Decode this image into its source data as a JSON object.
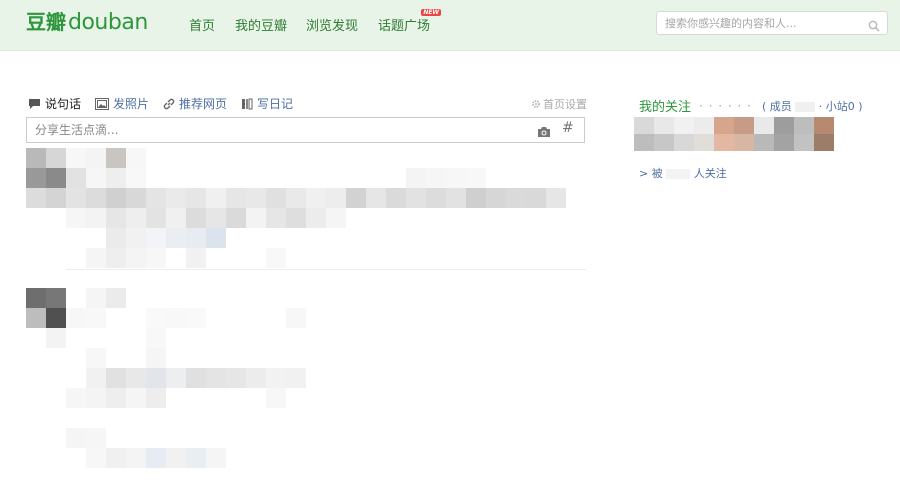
{
  "header": {
    "logo_cn": "豆瓣",
    "logo_en": "douban",
    "nav": [
      {
        "label": "首页"
      },
      {
        "label": "我的豆瓣"
      },
      {
        "label": "浏览发现"
      },
      {
        "label": "话题广场",
        "badge": "NEW"
      }
    ],
    "search_placeholder": "搜索你感兴趣的内容和人...",
    "brand_color": "#2e963d"
  },
  "share": {
    "tabs": [
      {
        "label": "说句话",
        "icon": "speech-bubble-icon",
        "active": true
      },
      {
        "label": "发照片",
        "icon": "image-icon"
      },
      {
        "label": "推荐网页",
        "icon": "link-icon"
      },
      {
        "label": "写日记",
        "icon": "book-icon"
      }
    ],
    "settings_label": "首页设置",
    "input_placeholder": "分享生活点滴...",
    "hash_symbol": "#"
  },
  "sidebar": {
    "follow_title": "我的关注",
    "follow_dots": "· · · · · ·",
    "follow_stats_prefix": "( 成员",
    "follow_stats_suffix": "· 小站0 )",
    "followed_by_prefix": "> 被",
    "followed_by_suffix": "人关注"
  }
}
